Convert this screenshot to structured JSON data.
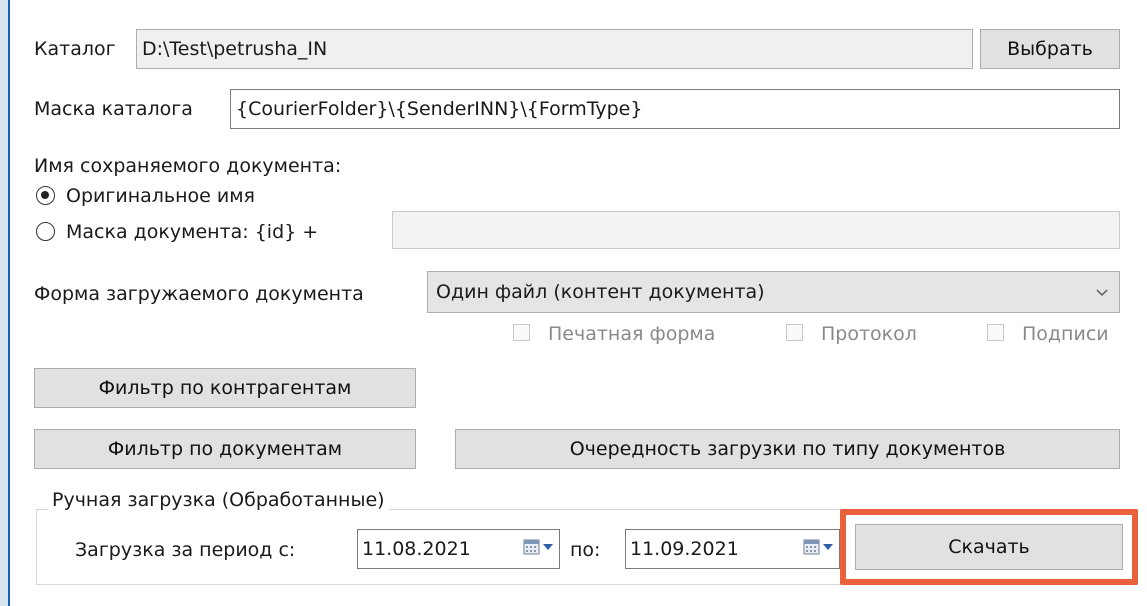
{
  "catalog": {
    "label": "Каталог",
    "path": "D:\\Test\\petrusha_IN",
    "choose_button": "Выбрать"
  },
  "catalog_mask": {
    "label": "Маска каталога",
    "value": "{CourierFolder}\\{SenderINN}\\{FormType}"
  },
  "saved_name": {
    "heading": "Имя сохраняемого документа:",
    "option_original": "Оригинальное имя",
    "option_mask": "Маска документа: {id} +",
    "mask_value": "",
    "selected": "original"
  },
  "doc_form": {
    "label": "Форма загружаемого документа",
    "selected": "Один файл (контент документа)",
    "checkboxes": [
      {
        "label": "Печатная форма",
        "checked": false
      },
      {
        "label": "Протокол",
        "checked": false
      },
      {
        "label": "Подписи",
        "checked": false
      }
    ]
  },
  "buttons": {
    "filter_contractors": "Фильтр по контрагентам",
    "filter_documents": "Фильтр по документам",
    "load_order": "Очередность загрузки по типу документов"
  },
  "manual": {
    "group_title": "Ручная загрузка (Обработанные)",
    "period_label": "Загрузка за период с:",
    "date_from": "11.08.2021",
    "to_label": "по:",
    "date_to": "11.09.2021",
    "download_button": "Скачать"
  },
  "colors": {
    "highlight": "#e8603c",
    "left_border": "#1b5fb4"
  }
}
